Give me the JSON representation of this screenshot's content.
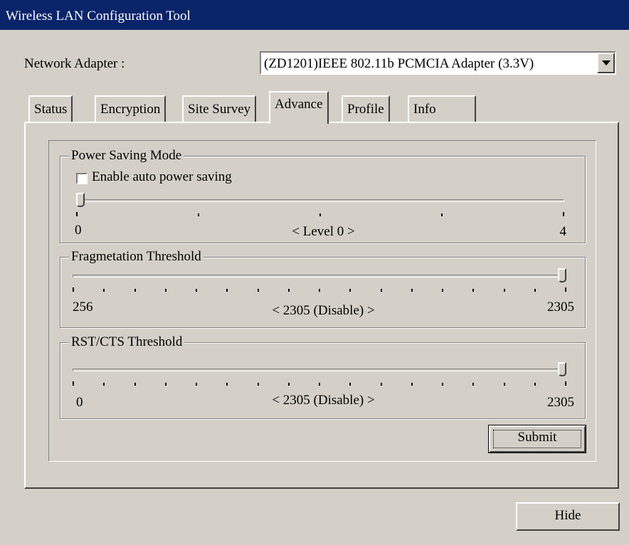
{
  "window": {
    "title": "Wireless LAN Configuration Tool"
  },
  "adapter": {
    "label": "Network Adapter :",
    "selected": "(ZD1201)IEEE 802.11b PCMCIA Adapter (3.3V)"
  },
  "tabs": [
    {
      "label": "Status",
      "active": false
    },
    {
      "label": "Encryption",
      "active": false
    },
    {
      "label": "Site Survey",
      "active": false
    },
    {
      "label": "Advance",
      "active": true
    },
    {
      "label": "Profile",
      "active": false
    },
    {
      "label": "Info",
      "active": false
    }
  ],
  "power_saving": {
    "group_title": "Power Saving Mode",
    "checkbox_label": "Enable auto power saving",
    "checked": false,
    "slider": {
      "min_label": "0",
      "max_label": "4",
      "value_label": "< Level 0 >",
      "min": 0,
      "max": 4,
      "value": 0
    }
  },
  "fragmentation": {
    "group_title": "Fragmetation Threshold",
    "slider": {
      "min_label": "256",
      "max_label": "2305",
      "value_label": "< 2305 (Disable) >",
      "min": 256,
      "max": 2305,
      "value": 2305
    }
  },
  "rts_cts": {
    "group_title": "RST/CTS Threshold",
    "slider": {
      "min_label": "0",
      "max_label": "2305",
      "value_label": "< 2305 (Disable) >",
      "min": 0,
      "max": 2305,
      "value": 2305
    }
  },
  "buttons": {
    "submit": "Submit",
    "hide": "Hide"
  },
  "colors": {
    "titlebar": "#0a246a",
    "face": "#d4d0c8"
  }
}
